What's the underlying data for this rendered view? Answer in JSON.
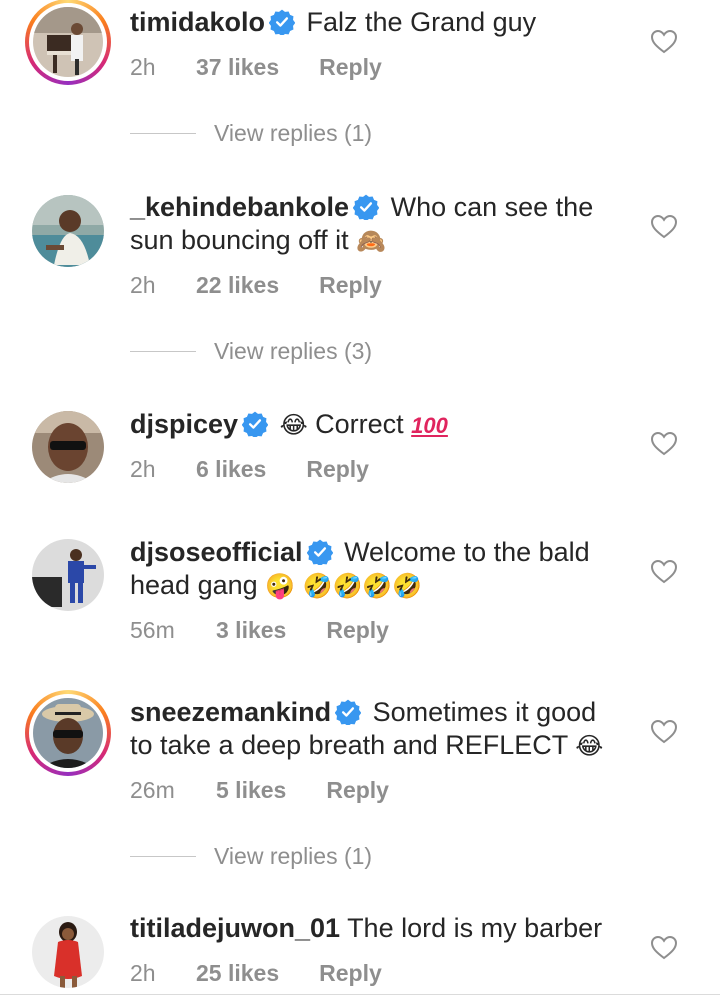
{
  "comments": [
    {
      "username": "timidakolo",
      "text": "Falz the Grand guy",
      "time": "2h",
      "likes": "37 likes",
      "reply": "Reply",
      "view_replies": "View replies (1)"
    },
    {
      "username": "_kehindebankole",
      "text_line1": "Who can see the",
      "text_line2": "sun bouncing off it",
      "emoji": "🙈",
      "time": "2h",
      "likes": "22 likes",
      "reply": "Reply",
      "view_replies": "View replies (3)"
    },
    {
      "username": "djspicey",
      "emoji": "😂",
      "text": "Correct",
      "hundred": "100",
      "time": "2h",
      "likes": "6 likes",
      "reply": "Reply"
    },
    {
      "username": "djsoseofficial",
      "text_line1": "Welcome to the bald",
      "text_line2": "head gang",
      "emoji": "🤪 🤣🤣🤣🤣",
      "time": "56m",
      "likes": "3 likes",
      "reply": "Reply"
    },
    {
      "username": "sneezemankind",
      "text_line1": "Sometimes it good",
      "text_line2": "to take a deep breath and REFLECT",
      "emoji": "😂",
      "time": "26m",
      "likes": "5 likes",
      "reply": "Reply",
      "view_replies": "View replies (1)"
    },
    {
      "username": "titiladejuwon_01",
      "text": "The lord is my barber",
      "time": "2h",
      "likes": "25 likes",
      "reply": "Reply"
    }
  ],
  "colors": {
    "verified": "#3897f0",
    "muted": "#8e8e8e",
    "text": "#262626"
  }
}
